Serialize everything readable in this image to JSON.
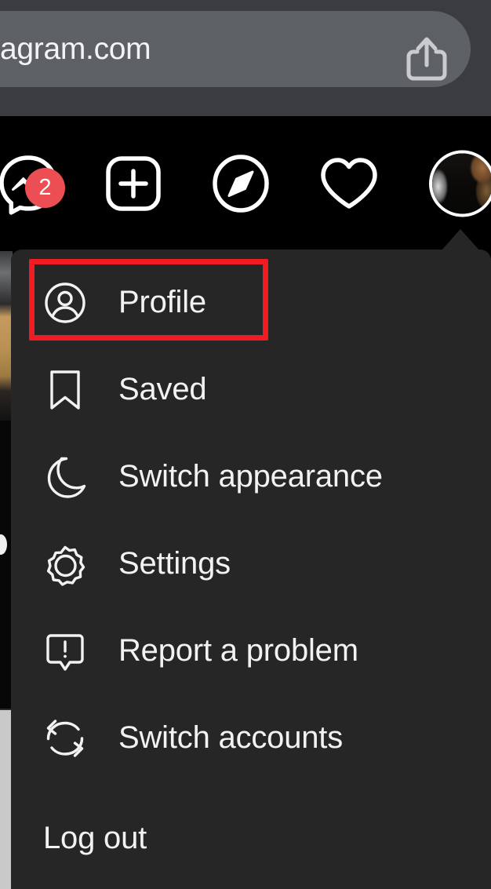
{
  "browser": {
    "url_text": "agram.com",
    "share_icon": "share-icon"
  },
  "navbar": {
    "items": [
      {
        "icon": "messenger-icon",
        "label": "Messages",
        "badge": "2"
      },
      {
        "icon": "plus-square-icon",
        "label": "New post",
        "badge": ""
      },
      {
        "icon": "compass-icon",
        "label": "Explore",
        "badge": ""
      },
      {
        "icon": "heart-icon",
        "label": "Notifications",
        "badge": ""
      }
    ],
    "avatar": {
      "name": "profile-avatar",
      "label": "Profile"
    }
  },
  "dropdown": {
    "items": [
      {
        "icon": "person-circle-icon",
        "label": "Profile",
        "highlighted": true
      },
      {
        "icon": "bookmark-icon",
        "label": "Saved",
        "highlighted": false
      },
      {
        "icon": "moon-icon",
        "label": "Switch appearance",
        "highlighted": false
      },
      {
        "icon": "gear-icon",
        "label": "Settings",
        "highlighted": false
      },
      {
        "icon": "report-problem-icon",
        "label": "Report a problem",
        "highlighted": false
      },
      {
        "icon": "switch-accounts-icon",
        "label": "Switch accounts",
        "highlighted": false
      },
      {
        "icon": "",
        "label": "Log out",
        "highlighted": false
      }
    ]
  },
  "annotation": {
    "target_label": "Profile",
    "color": "#f01c23"
  },
  "colors": {
    "page_background": "#000000",
    "menu_background": "#262626",
    "browser_chrome": "#3a3c40",
    "url_pill": "#5d6166",
    "badge_red": "#ed4e54",
    "text_primary": "#f2f2f2"
  }
}
